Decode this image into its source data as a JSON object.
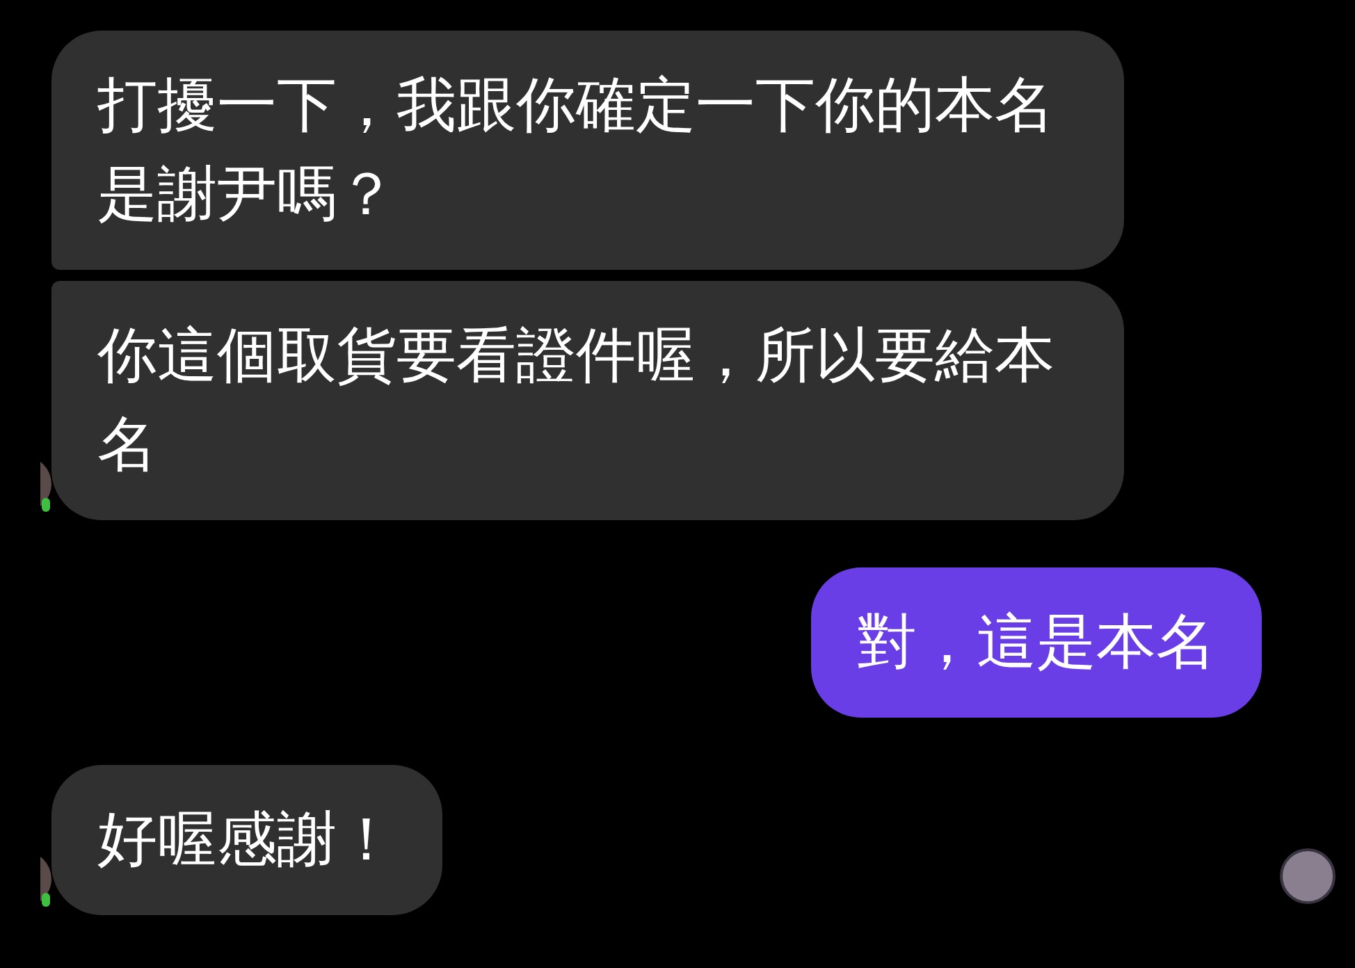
{
  "messages": [
    {
      "kind": "incoming",
      "text": "打擾一下，我跟你確定一下你的本名是謝尹嗎？"
    },
    {
      "kind": "incoming",
      "text": "你這個取貨要看證件喔，所以要給本名"
    },
    {
      "kind": "outgoing",
      "text": "對，這是本名"
    },
    {
      "kind": "incoming",
      "text": "好喔感謝！"
    }
  ]
}
